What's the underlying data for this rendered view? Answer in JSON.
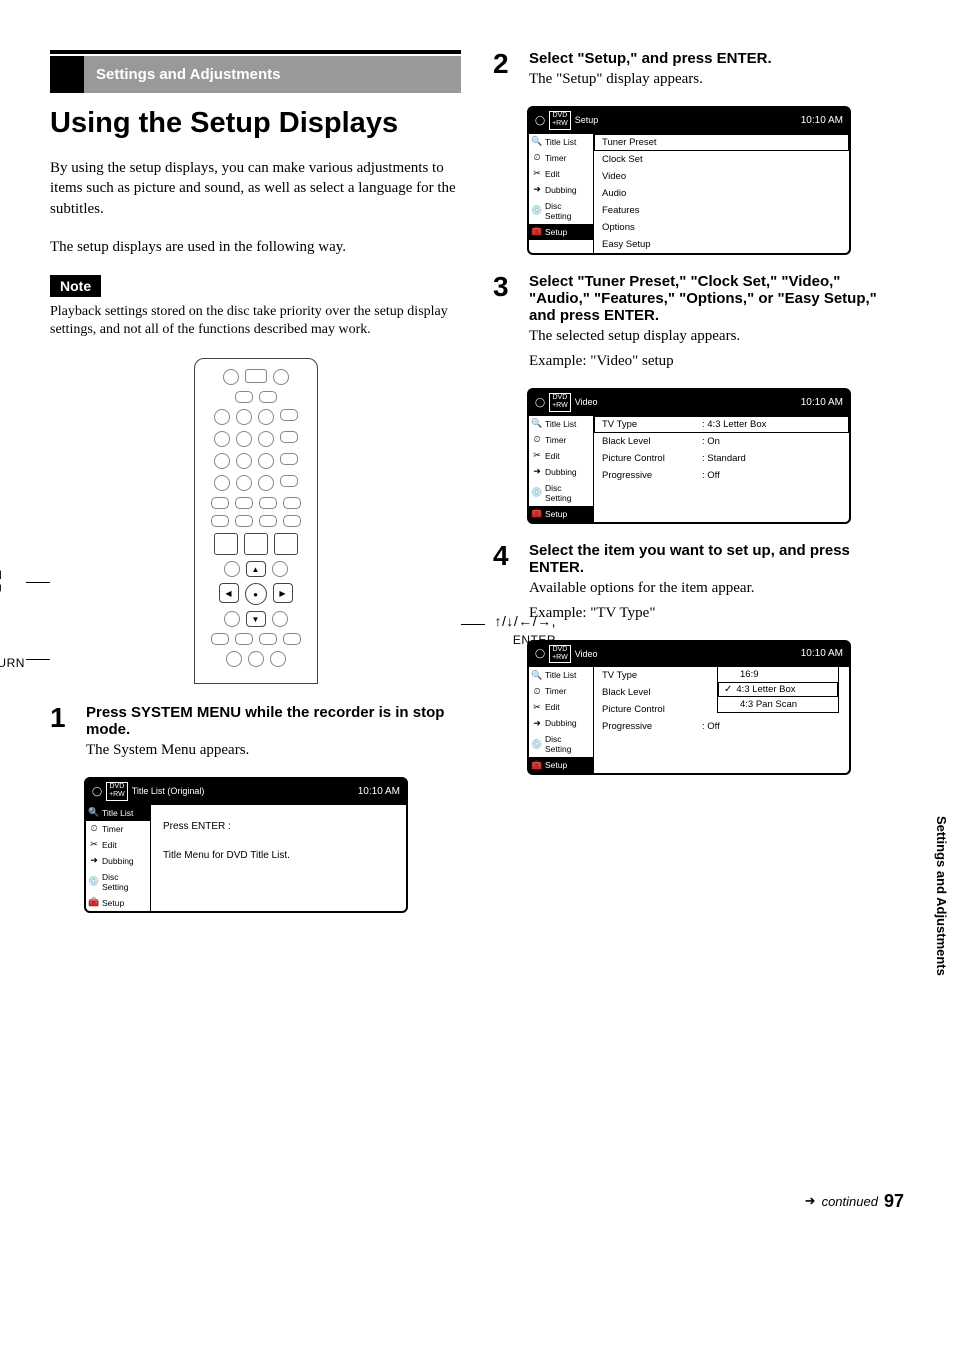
{
  "header": {
    "section": "Settings and Adjustments"
  },
  "title": "Using the Setup Displays",
  "intro1": "By using the setup displays, you can make various adjustments to items such as picture and sound, as well as select a language for the subtitles.",
  "intro2": "The setup displays are used in the following way.",
  "note": {
    "label": "Note",
    "text": "Playback settings stored on the disc take priority over the setup display settings, and not all of the functions described may work."
  },
  "remote": {
    "labels": {
      "system_menu": "SYSTEM MENU",
      "return": "RETURN",
      "arrows": "↑/↓/←/→,",
      "enter": "ENTER"
    }
  },
  "steps": {
    "s1": {
      "num": "1",
      "heading": "Press SYSTEM MENU while the recorder is in stop mode.",
      "text": "The System Menu appears."
    },
    "s2": {
      "num": "2",
      "heading": "Select \"Setup,\" and press ENTER.",
      "text": "The \"Setup\" display appears."
    },
    "s3": {
      "num": "3",
      "heading": "Select \"Tuner Preset,\" \"Clock Set,\" \"Video,\" \"Audio,\" \"Features,\" \"Options,\" or \"Easy Setup,\" and press ENTER.",
      "text": "The selected setup display appears.",
      "example": "Example: \"Video\" setup"
    },
    "s4": {
      "num": "4",
      "heading": "Select the item you want to set up, and press ENTER.",
      "text": "Available options for the item appear.",
      "example": "Example: \"TV Type\""
    }
  },
  "osd_common": {
    "dvd_label": "DVD +RW",
    "time": "10:10 AM",
    "sidebar": [
      "Title List",
      "Timer",
      "Edit",
      "Dubbing",
      "Disc Setting",
      "Setup"
    ]
  },
  "osd1": {
    "title": "Title List (Original)",
    "line1": "Press ENTER :",
    "line2": "Title Menu for DVD Title List."
  },
  "osd2": {
    "title": "Setup",
    "items": [
      "Tuner Preset",
      "Clock Set",
      "Video",
      "Audio",
      "Features",
      "Options",
      "Easy Setup"
    ]
  },
  "osd3": {
    "title": "Video",
    "rows": [
      {
        "k": "TV Type",
        "v": ":  4:3 Letter Box"
      },
      {
        "k": "Black Level",
        "v": ":  On"
      },
      {
        "k": "Picture Control",
        "v": ":  Standard"
      },
      {
        "k": "Progressive",
        "v": ":  Off"
      }
    ]
  },
  "osd4": {
    "title": "Video",
    "row0": {
      "k": "TV Type",
      "v": ""
    },
    "options": [
      "16:9",
      "4:3 Letter Box",
      "4:3 Pan Scan"
    ],
    "rows_below": [
      {
        "k": "Black Level",
        "v": ""
      },
      {
        "k": "Picture Control",
        "v": ""
      },
      {
        "k": "Progressive",
        "v": ":  Off"
      }
    ]
  },
  "footer": {
    "continued": "continued",
    "page": "97"
  },
  "sidetab": "Settings and Adjustments"
}
